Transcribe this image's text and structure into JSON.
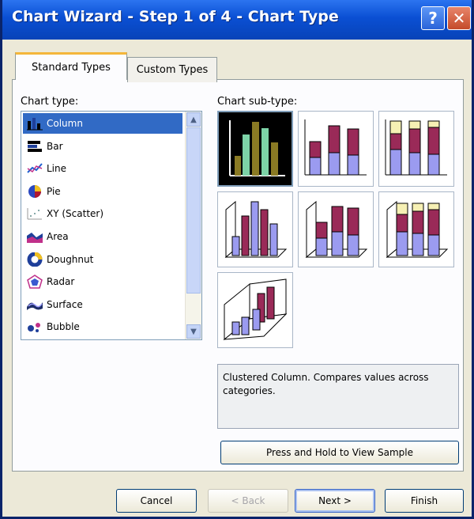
{
  "window": {
    "title": "Chart Wizard - Step 1 of 4 - Chart Type",
    "help_glyph": "?",
    "close_glyph": "✕"
  },
  "tabs": [
    {
      "label": "Standard Types",
      "active": true
    },
    {
      "label": "Custom Types",
      "active": false
    }
  ],
  "chart_type_label": "Chart type:",
  "chart_types": [
    {
      "label": "Column",
      "icon": "column-chart-icon",
      "selected": true
    },
    {
      "label": "Bar",
      "icon": "bar-chart-icon",
      "selected": false
    },
    {
      "label": "Line",
      "icon": "line-chart-icon",
      "selected": false
    },
    {
      "label": "Pie",
      "icon": "pie-chart-icon",
      "selected": false
    },
    {
      "label": "XY (Scatter)",
      "icon": "scatter-chart-icon",
      "selected": false
    },
    {
      "label": "Area",
      "icon": "area-chart-icon",
      "selected": false
    },
    {
      "label": "Doughnut",
      "icon": "doughnut-chart-icon",
      "selected": false
    },
    {
      "label": "Radar",
      "icon": "radar-chart-icon",
      "selected": false
    },
    {
      "label": "Surface",
      "icon": "surface-chart-icon",
      "selected": false
    },
    {
      "label": "Bubble",
      "icon": "bubble-chart-icon",
      "selected": false
    }
  ],
  "subtype_label": "Chart sub-type:",
  "subtypes": [
    {
      "icon": "clustered-column-icon",
      "selected": true
    },
    {
      "icon": "stacked-column-icon",
      "selected": false
    },
    {
      "icon": "100-percent-stacked-column-icon",
      "selected": false
    },
    {
      "icon": "3d-clustered-column-icon",
      "selected": false
    },
    {
      "icon": "3d-stacked-column-icon",
      "selected": false
    },
    {
      "icon": "3d-100-percent-stacked-column-icon",
      "selected": false
    },
    {
      "icon": "3d-column-icon",
      "selected": false
    }
  ],
  "description": "Clustered Column. Compares values across categories.",
  "buttons": {
    "view_sample": "Press and Hold to View Sample",
    "cancel": "Cancel",
    "back": "< Back",
    "next": "Next >",
    "finish": "Finish"
  },
  "colors": {
    "title_bar": "#0a4fd3",
    "selection": "#316ac5",
    "series_green": "#7dd3a7",
    "series_olive": "#8a7a24",
    "series_maroon": "#9a2a58",
    "series_blue": "#9b9bf0",
    "series_cream": "#f6f0b4"
  }
}
